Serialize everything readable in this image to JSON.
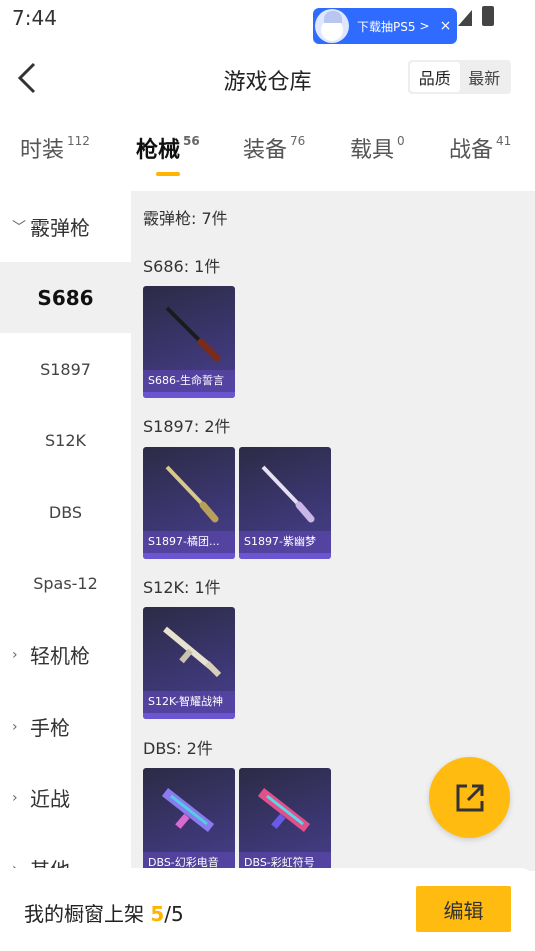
{
  "status": {
    "time": "7:44",
    "promo_text": "下载抽PS5",
    "promo_chevron": ">",
    "promo_close": "×"
  },
  "header": {
    "title": "游戏仓库",
    "sort_quality": "品质",
    "sort_latest": "最新"
  },
  "tabs": [
    {
      "label": "时装",
      "count": "112"
    },
    {
      "label": "枪械",
      "count": "56"
    },
    {
      "label": "装备",
      "count": "76"
    },
    {
      "label": "载具",
      "count": "0"
    },
    {
      "label": "战备",
      "count": "41"
    }
  ],
  "sidebar": [
    {
      "label": "霰弹枪",
      "caret": "﹀"
    },
    {
      "label": "S686"
    },
    {
      "label": "S1897"
    },
    {
      "label": "S12K"
    },
    {
      "label": "DBS"
    },
    {
      "label": "Spas-12"
    },
    {
      "label": "轻机枪",
      "caret": "›"
    },
    {
      "label": "手枪",
      "caret": "›"
    },
    {
      "label": "近战",
      "caret": "›"
    },
    {
      "label": "其他",
      "caret": "›"
    }
  ],
  "content": {
    "summary": "霰弹枪: 7件",
    "sections": [
      {
        "title": "S686: 1件",
        "items": [
          "S686-生命誓言"
        ]
      },
      {
        "title": "S1897: 2件",
        "items": [
          "S1897-橘团...",
          "S1897-紫幽梦"
        ]
      },
      {
        "title": "S12K: 1件",
        "items": [
          "S12K-智耀战神"
        ]
      },
      {
        "title": "DBS: 2件",
        "items": [
          "DBS-幻彩电音",
          "DBS-彩虹符号"
        ]
      }
    ]
  },
  "bottom": {
    "text": "我的橱窗上架",
    "count": "5",
    "total": "/5",
    "edit_label": "编辑"
  },
  "colors": {
    "accent": "#ffbb10",
    "card_bg": "#3b3670",
    "panel_bg": "#f0f0f0"
  }
}
